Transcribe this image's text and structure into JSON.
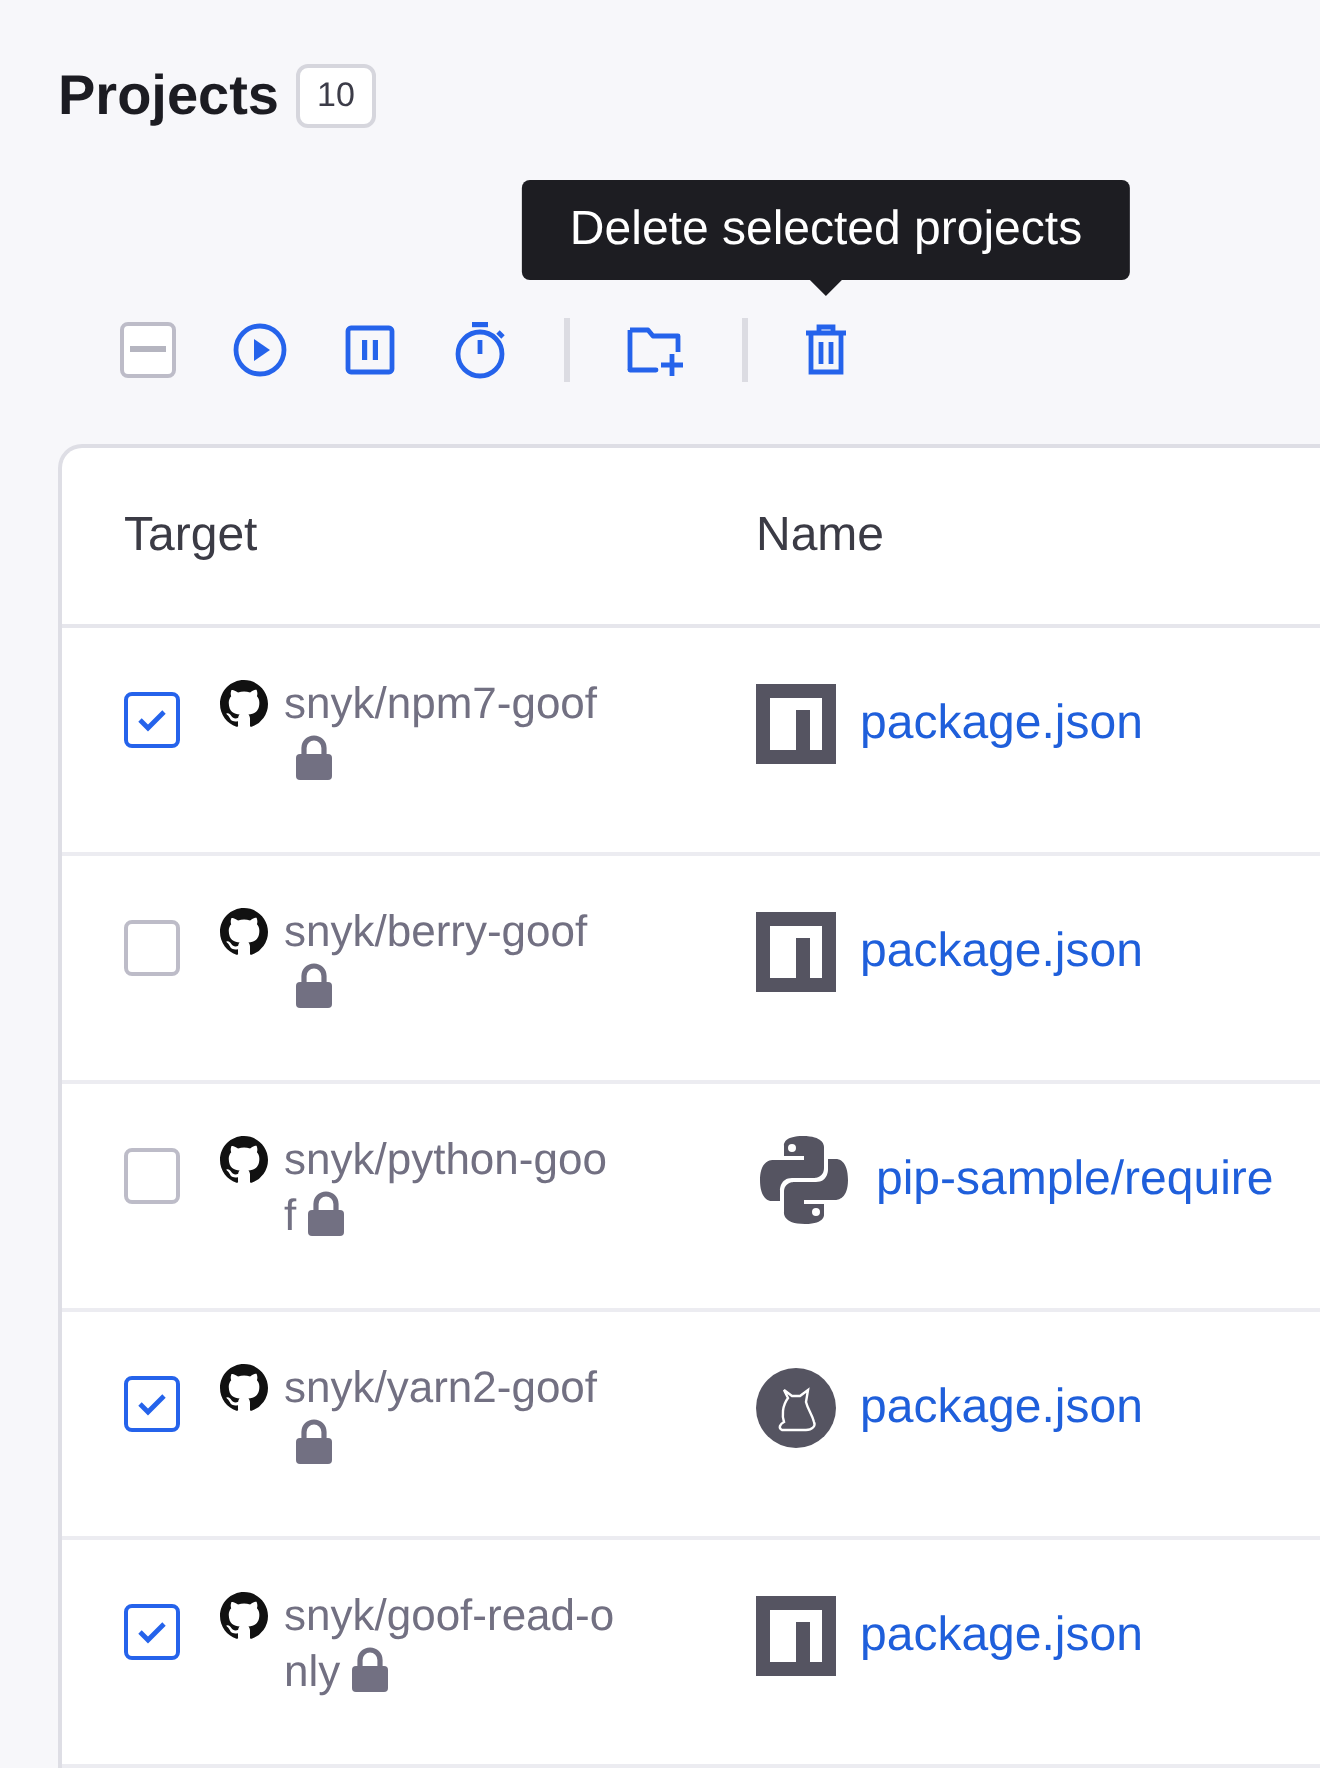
{
  "header": {
    "title": "Projects",
    "count": "10"
  },
  "toolbar": {
    "select_all": {
      "indeterminate": true
    },
    "tooltip": "Delete selected projects"
  },
  "table": {
    "columns": [
      "Target",
      "Name"
    ],
    "rows": [
      {
        "checked": true,
        "target": "snyk/npm7-goof",
        "private": true,
        "kind": "npm",
        "file": "package.json"
      },
      {
        "checked": false,
        "target": "snyk/berry-goof",
        "private": true,
        "kind": "npm",
        "file": "package.json"
      },
      {
        "checked": false,
        "target": "snyk/python-goof",
        "private": true,
        "kind": "python",
        "file": "pip-sample/require"
      },
      {
        "checked": true,
        "target": "snyk/yarn2-goof",
        "private": true,
        "kind": "yarn",
        "file": "package.json"
      },
      {
        "checked": true,
        "target": "snyk/goof-read-only",
        "private": true,
        "kind": "npm",
        "file": "package.json"
      }
    ]
  }
}
